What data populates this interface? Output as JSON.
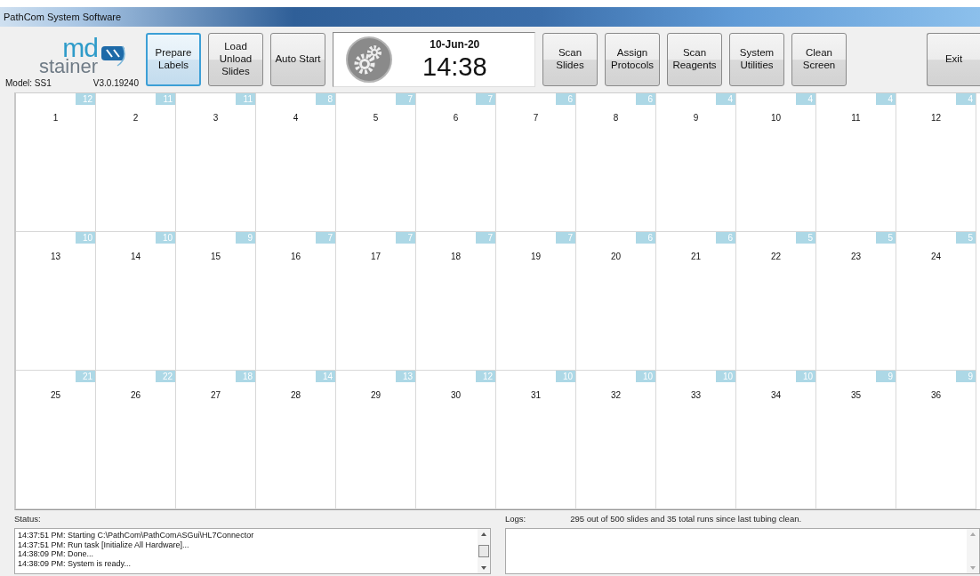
{
  "window": {
    "title": "PathCom System Software"
  },
  "logo": {
    "line_1": "md",
    "line_2": "stainer"
  },
  "model": "Model: SS1",
  "version": "V3.0.19240",
  "left_buttons": [
    {
      "label": "Prepare\nLabels",
      "selected": true
    },
    {
      "label": "Load\nUnload\nSlides",
      "selected": false
    },
    {
      "label": "Auto Start",
      "selected": false
    }
  ],
  "clock": {
    "date": "10-Jun-20",
    "time": "14:38"
  },
  "right_buttons": [
    {
      "label": "Scan\nSlides",
      "selected": false
    },
    {
      "label": "Assign\nProtocols",
      "selected": false
    },
    {
      "label": "Scan\nReagents",
      "selected": false
    },
    {
      "label": "System\nUtilities",
      "selected": false
    },
    {
      "label": "Clean\nScreen",
      "selected": false
    }
  ],
  "exit_button": "Exit",
  "slots": [
    {
      "number": "1",
      "count": "12"
    },
    {
      "number": "2",
      "count": "11"
    },
    {
      "number": "3",
      "count": "11"
    },
    {
      "number": "4",
      "count": "8"
    },
    {
      "number": "5",
      "count": "7"
    },
    {
      "number": "6",
      "count": "7"
    },
    {
      "number": "7",
      "count": "6"
    },
    {
      "number": "8",
      "count": "6"
    },
    {
      "number": "9",
      "count": "4"
    },
    {
      "number": "10",
      "count": "4"
    },
    {
      "number": "11",
      "count": "4"
    },
    {
      "number": "12",
      "count": "4"
    },
    {
      "number": "13",
      "count": "10"
    },
    {
      "number": "14",
      "count": "10"
    },
    {
      "number": "15",
      "count": "9"
    },
    {
      "number": "16",
      "count": "7"
    },
    {
      "number": "17",
      "count": "7"
    },
    {
      "number": "18",
      "count": "7"
    },
    {
      "number": "19",
      "count": "7"
    },
    {
      "number": "20",
      "count": "6"
    },
    {
      "number": "21",
      "count": "6"
    },
    {
      "number": "22",
      "count": "5"
    },
    {
      "number": "23",
      "count": "5"
    },
    {
      "number": "24",
      "count": "5"
    },
    {
      "number": "25",
      "count": "21"
    },
    {
      "number": "26",
      "count": "22"
    },
    {
      "number": "27",
      "count": "18"
    },
    {
      "number": "28",
      "count": "14"
    },
    {
      "number": "29",
      "count": "13"
    },
    {
      "number": "30",
      "count": "12"
    },
    {
      "number": "31",
      "count": "10"
    },
    {
      "number": "32",
      "count": "10"
    },
    {
      "number": "33",
      "count": "10"
    },
    {
      "number": "34",
      "count": "10"
    },
    {
      "number": "35",
      "count": "9"
    },
    {
      "number": "36",
      "count": "9"
    }
  ],
  "status": {
    "label": "Status:",
    "lines": [
      "14:37:51 PM: Starting C:\\PathCom\\PathComASGui\\HL7Connector",
      "14:37:51 PM: Run task [Initialize All Hardware]...",
      "14:38:09 PM: Done...",
      "14:38:09 PM: System is ready..."
    ]
  },
  "logs": {
    "label": "Logs:",
    "summary": "295 out of 500 slides and  35  total runs since last tubing clean."
  }
}
